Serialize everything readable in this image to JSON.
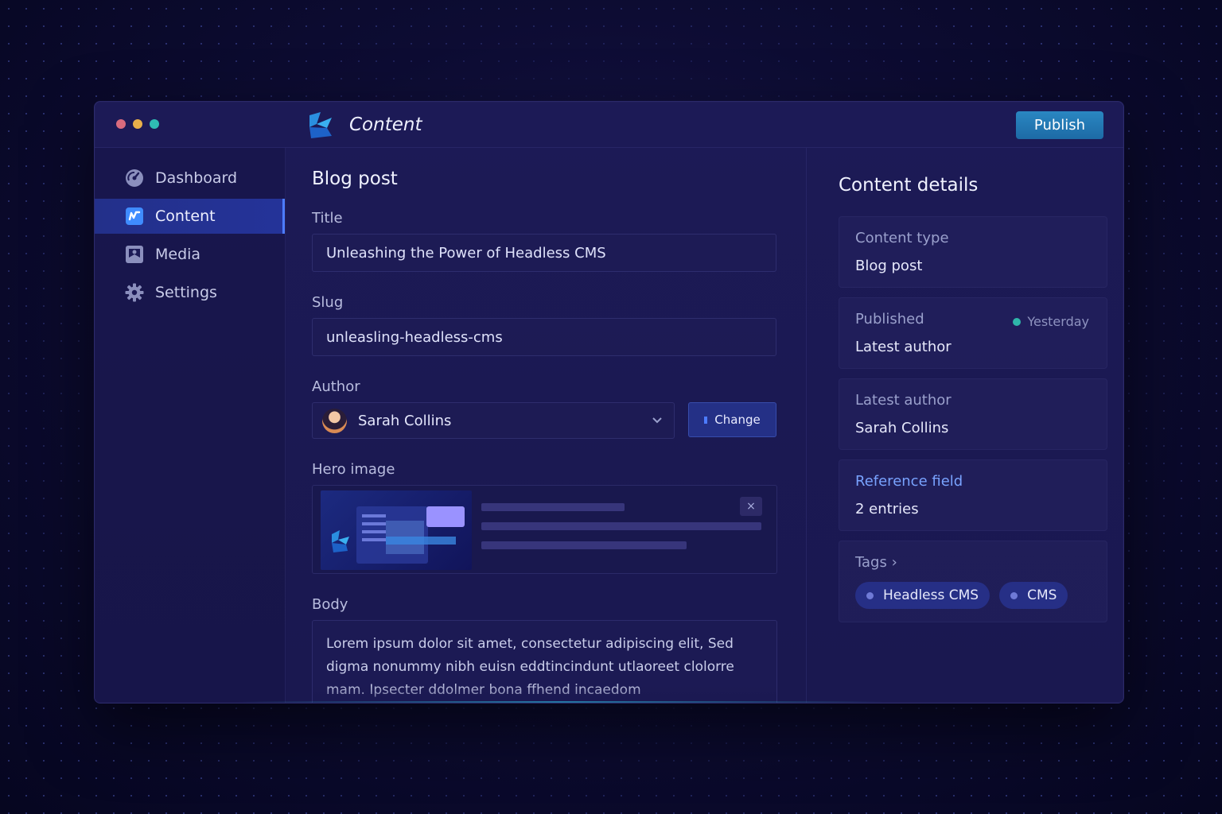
{
  "window": {
    "title": "Content",
    "traffic_colors": [
      "#d96b7e",
      "#e8b04a",
      "#2fbcb4"
    ],
    "publish_label": "Publish"
  },
  "sidebar": {
    "items": [
      {
        "label": "Dashboard",
        "icon": "dashboard-gauge-icon",
        "active": false
      },
      {
        "label": "Content",
        "icon": "content-edit-icon",
        "active": true
      },
      {
        "label": "Media",
        "icon": "media-image-icon",
        "active": false
      },
      {
        "label": "Settings",
        "icon": "gear-icon",
        "active": false
      }
    ]
  },
  "main": {
    "section_title": "Blog post",
    "title_label": "Title",
    "title_value": "Unleashing the Power of Headless CMS",
    "slug_label": "Slug",
    "slug_value": "unleasling-headless-cms",
    "author_label": "Author",
    "author_value": "Sarah Collins",
    "change_label": "Change",
    "hero_label": "Hero image",
    "hero_close": "×",
    "body_label": "Body",
    "body_text": "Lorem ipsum dolor sit amet, consectetur adipiscing elit, Sed digma nonummy nibh euisn eddtincindunt utlaoreet clolorre mam. Ipsecter ddolmer bona ffhend incaedom"
  },
  "details": {
    "title": "Content details",
    "content_type_label": "Content type",
    "content_type_value": "Blog post",
    "published_label": "Published",
    "published_status": "Yesterday",
    "published_value": "Latest author",
    "latest_author_label": "Latest author",
    "latest_author_value": "Sarah Collins",
    "reference_label": "Reference field",
    "reference_value": "2 entries",
    "tags_label": "Tags ›",
    "tags": [
      "Headless CMS",
      "CMS"
    ]
  },
  "colors": {
    "accent": "#4d7cff",
    "publish": "#2a87c2",
    "status_dot": "#2fb6a9",
    "reference": "#79a3ff"
  }
}
